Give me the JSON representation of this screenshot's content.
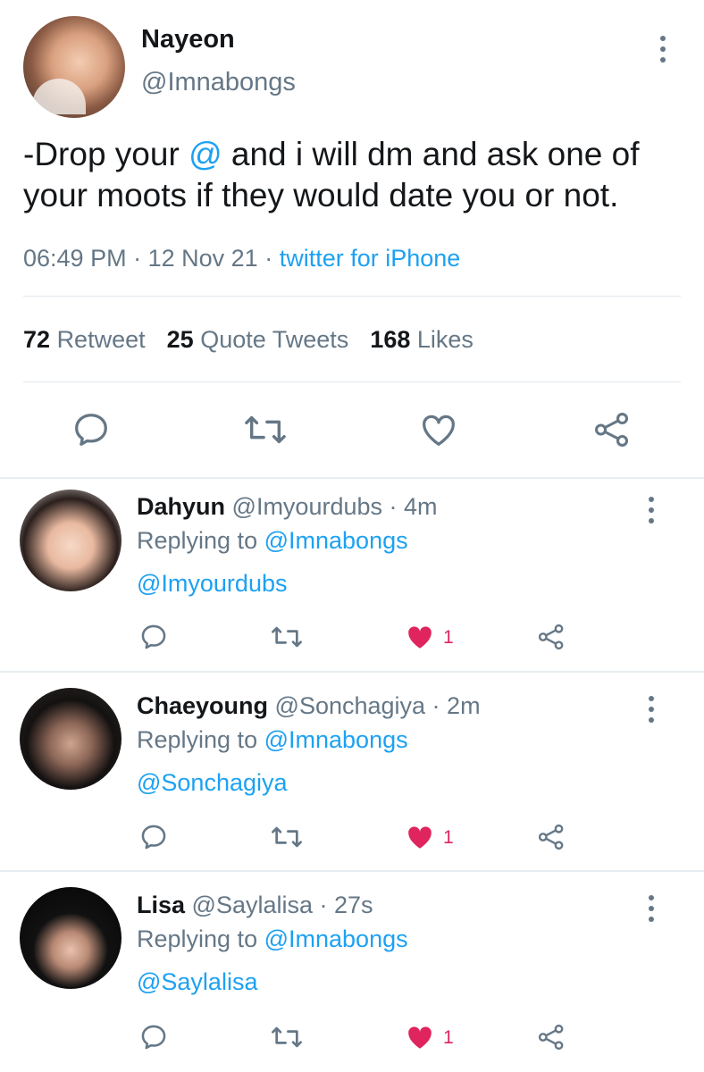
{
  "main": {
    "name": "Nayeon",
    "handle": "@Imnabongs",
    "text_before": "-Drop your ",
    "text_mention": "@",
    "text_after": " and i will dm and ask one of your moots if they would date you or not.",
    "time": "06:49 PM",
    "date": "12 Nov 21",
    "source": "twitter for iPhone",
    "stats": {
      "retweets_count": "72",
      "retweets_label": "Retweet",
      "quotes_count": "25",
      "quotes_label": "Quote Tweets",
      "likes_count": "168",
      "likes_label": "Likes"
    }
  },
  "replies": [
    {
      "name": "Dahyun",
      "handle": "@Imyourdubs",
      "time": "4m",
      "replying_label": "Replying to",
      "replying_to": "@Imnabongs",
      "body": "@Imyourdubs",
      "likes": "1"
    },
    {
      "name": "Chaeyoung",
      "handle": "@Sonchagiya",
      "time": "2m",
      "replying_label": "Replying to",
      "replying_to": "@Imnabongs",
      "body": "@Sonchagiya",
      "likes": "1"
    },
    {
      "name": "Lisa",
      "handle": "@Saylalisa",
      "time": "27s",
      "replying_label": "Replying to",
      "replying_to": "@Imnabongs",
      "body": "@Saylalisa",
      "likes": "1"
    }
  ],
  "icons": [
    "reply-icon",
    "retweet-icon",
    "like-icon",
    "share-icon",
    "more-icon"
  ],
  "colors": {
    "accent": "#1da1f2",
    "like": "#e0245e",
    "muted": "#657786",
    "text": "#14171a"
  }
}
